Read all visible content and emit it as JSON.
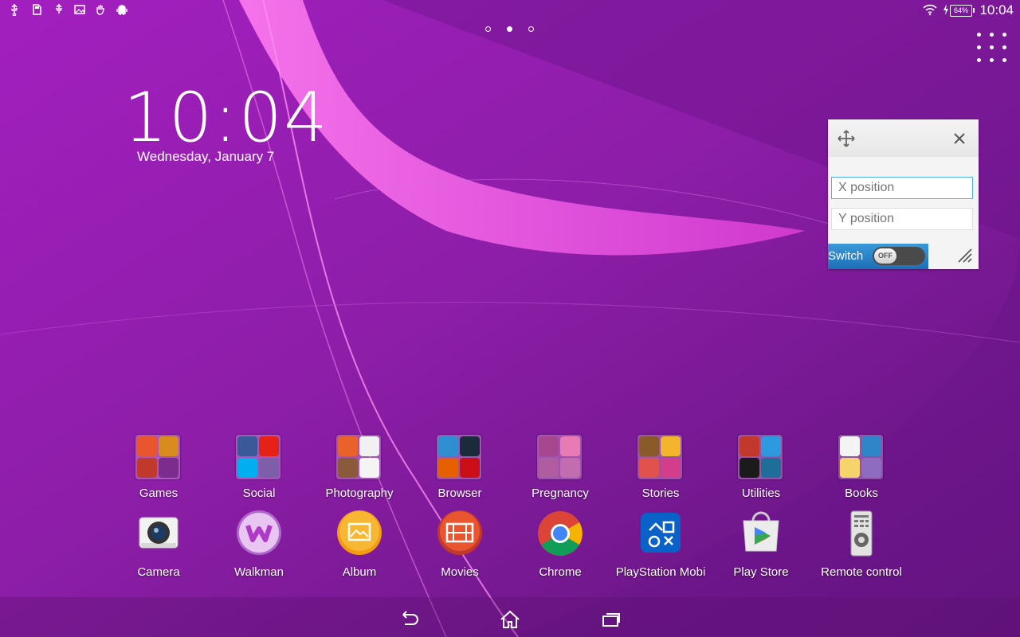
{
  "status_bar": {
    "left_icons": [
      "usb-icon",
      "sd-card-icon",
      "usb-debug-icon",
      "image-icon",
      "hand-icon",
      "android-icon"
    ],
    "wifi": "wifi-icon",
    "charging": "charging-icon",
    "battery_label": "64%",
    "time": "10:04"
  },
  "home": {
    "page_count": 3,
    "active_page": 2,
    "clock": {
      "time": "10:04",
      "date": "Wednesday, January 7"
    },
    "apps_button": "apps-grid-icon"
  },
  "widget": {
    "move_icon": "move-icon",
    "close_icon": "close-icon",
    "x_placeholder": "X position",
    "y_placeholder": "Y position",
    "switch_label": "Switch",
    "toggle_state": "OFF",
    "resize_icon": "resize-handle-icon"
  },
  "folders": [
    {
      "label": "Games",
      "tiles": [
        "#e8552f",
        "#d98b1d",
        "#c0392b",
        "#7b2c8c"
      ]
    },
    {
      "label": "Social",
      "tiles": [
        "#3b5998",
        "#e62117",
        "#00aff0",
        "#7d5ea8"
      ]
    },
    {
      "label": "Photography",
      "tiles": [
        "#e9622b",
        "#f1f1f1",
        "#8a5a3b",
        "#f4f4f4"
      ]
    },
    {
      "label": "Browser",
      "tiles": [
        "#2f8fd0",
        "#1b2b3a",
        "#e66000",
        "#cc0f16"
      ]
    },
    {
      "label": "Pregnancy",
      "tiles": [
        "#a6488f",
        "#e87ab6",
        "#b05ca0",
        "#c26db0"
      ]
    },
    {
      "label": "Stories",
      "tiles": [
        "#8a5a2b",
        "#f3b52c",
        "#e0524b",
        "#d43c8c"
      ]
    },
    {
      "label": "Utilities",
      "tiles": [
        "#c0392b",
        "#2d9ae0",
        "#1b1b1b",
        "#1f6e9a"
      ]
    },
    {
      "label": "Books",
      "tiles": [
        "#f4f4f4",
        "#2e86c9",
        "#f6d36b",
        "#8e6cc0"
      ]
    }
  ],
  "apps": [
    {
      "label": "Camera",
      "icon": "camera-icon"
    },
    {
      "label": "Walkman",
      "icon": "walkman-icon"
    },
    {
      "label": "Album",
      "icon": "album-icon"
    },
    {
      "label": "Movies",
      "icon": "movies-icon"
    },
    {
      "label": "Chrome",
      "icon": "chrome-icon"
    },
    {
      "label": "PlayStation Mobi",
      "icon": "playstation-icon"
    },
    {
      "label": "Play Store",
      "icon": "play-store-icon"
    },
    {
      "label": "Remote control",
      "icon": "remote-control-icon"
    }
  ],
  "nav_bar": {
    "back": "back-icon",
    "home": "home-icon",
    "recents": "recents-icon"
  },
  "colors": {
    "wallpaper": "#8a1fa8",
    "accent": "#ff6fe6",
    "widget_switch": "#2a83c9"
  }
}
